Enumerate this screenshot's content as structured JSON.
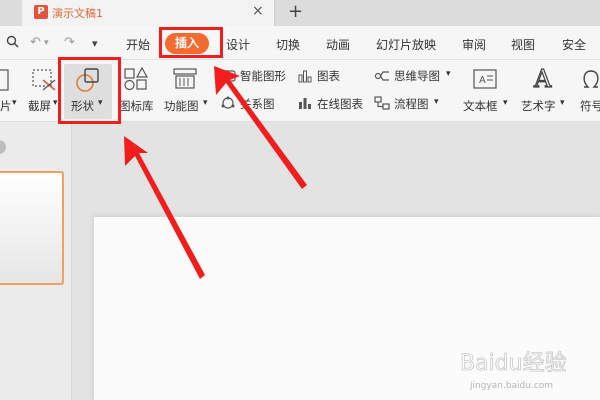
{
  "tab": {
    "title": "演示文稿1",
    "icon_letter": "P",
    "close": "×",
    "new": "+"
  },
  "menu": {
    "undo": "↶",
    "redo": "↷",
    "more": "▾",
    "items": [
      "开始",
      "插入",
      "设计",
      "切换",
      "动画",
      "幻灯片放映",
      "审阅",
      "视图",
      "安全"
    ]
  },
  "ribbon": {
    "screenshot": "截屏",
    "shape": "形状",
    "icon_lib": "图标库",
    "func_chart": "功能图",
    "smart_graphic": "智能图形",
    "chart": "图表",
    "relation": "关系图",
    "online_chart": "在线图表",
    "mindmap": "思维导图",
    "flowchart": "流程图",
    "textbox": "文本框",
    "art_text": "艺术字",
    "symbol": "符号",
    "left_partial": "片"
  },
  "watermark": {
    "brand": "Baidu经验",
    "url": "jingyan.baidu.com"
  }
}
